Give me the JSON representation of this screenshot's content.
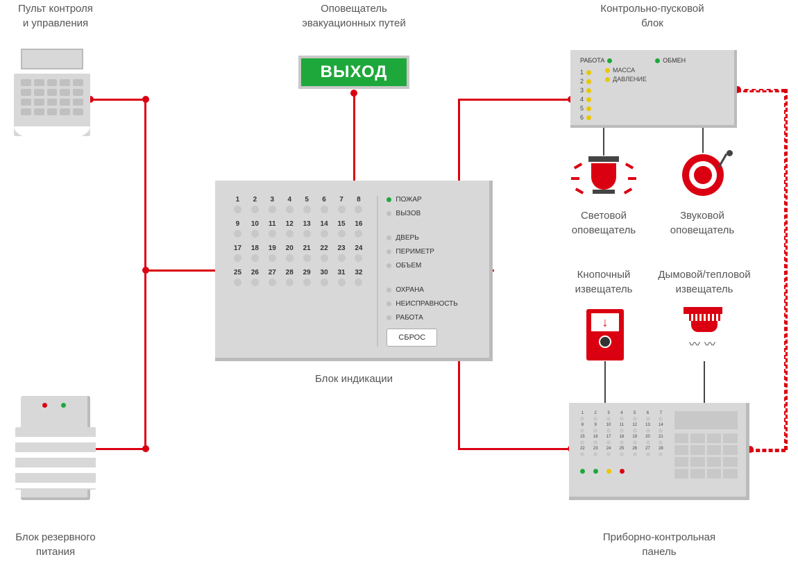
{
  "labels": {
    "keypad": "Пульт контроля\nи управления",
    "exit_sign": "Оповещатель\nэвакуационных путей",
    "launch_block": "Контрольно-пусковой\nблок",
    "indicator_block": "Блок индикации",
    "power_block": "Блок резервного\nпитания",
    "light_alarm": "Световой\nоповещатель",
    "sound_alarm": "Звуковой\nоповещатель",
    "call_point": "Кнопочный\nизвещатель",
    "smoke_detector": "Дымовой/тепловой\nизвещатель",
    "control_panel": "Приборно-контрольная\nпанель"
  },
  "exit_sign_text": "ВЫХОД",
  "launch_block": {
    "left_top": "РАБОТА",
    "right": [
      "ОБМЕН",
      "МАССА",
      "ДАВЛЕНИЕ"
    ],
    "numbers": [
      "1",
      "2",
      "3",
      "4",
      "5",
      "6"
    ]
  },
  "indicator": {
    "numbers": [
      "1",
      "2",
      "3",
      "4",
      "5",
      "6",
      "7",
      "8",
      "9",
      "10",
      "11",
      "12",
      "13",
      "14",
      "15",
      "16",
      "17",
      "18",
      "19",
      "20",
      "21",
      "22",
      "23",
      "24",
      "25",
      "26",
      "27",
      "28",
      "29",
      "30",
      "31",
      "32"
    ],
    "statuses": [
      "ПОЖАР",
      "ВЫЗОВ",
      "ДВЕРЬ",
      "ПЕРИМЕТР",
      "ОБЪЕМ",
      "ОХРАНА",
      "НЕИСПРАВНОСТЬ",
      "РАБОТА"
    ],
    "reset": "СБРОС"
  },
  "control_panel_numbers": [
    "1",
    "2",
    "3",
    "4",
    "5",
    "6",
    "7",
    "8",
    "9",
    "10",
    "11",
    "12",
    "13",
    "14",
    "15",
    "16",
    "17",
    "18",
    "19",
    "20",
    "21",
    "22",
    "23",
    "24",
    "25",
    "26",
    "27",
    "28"
  ]
}
